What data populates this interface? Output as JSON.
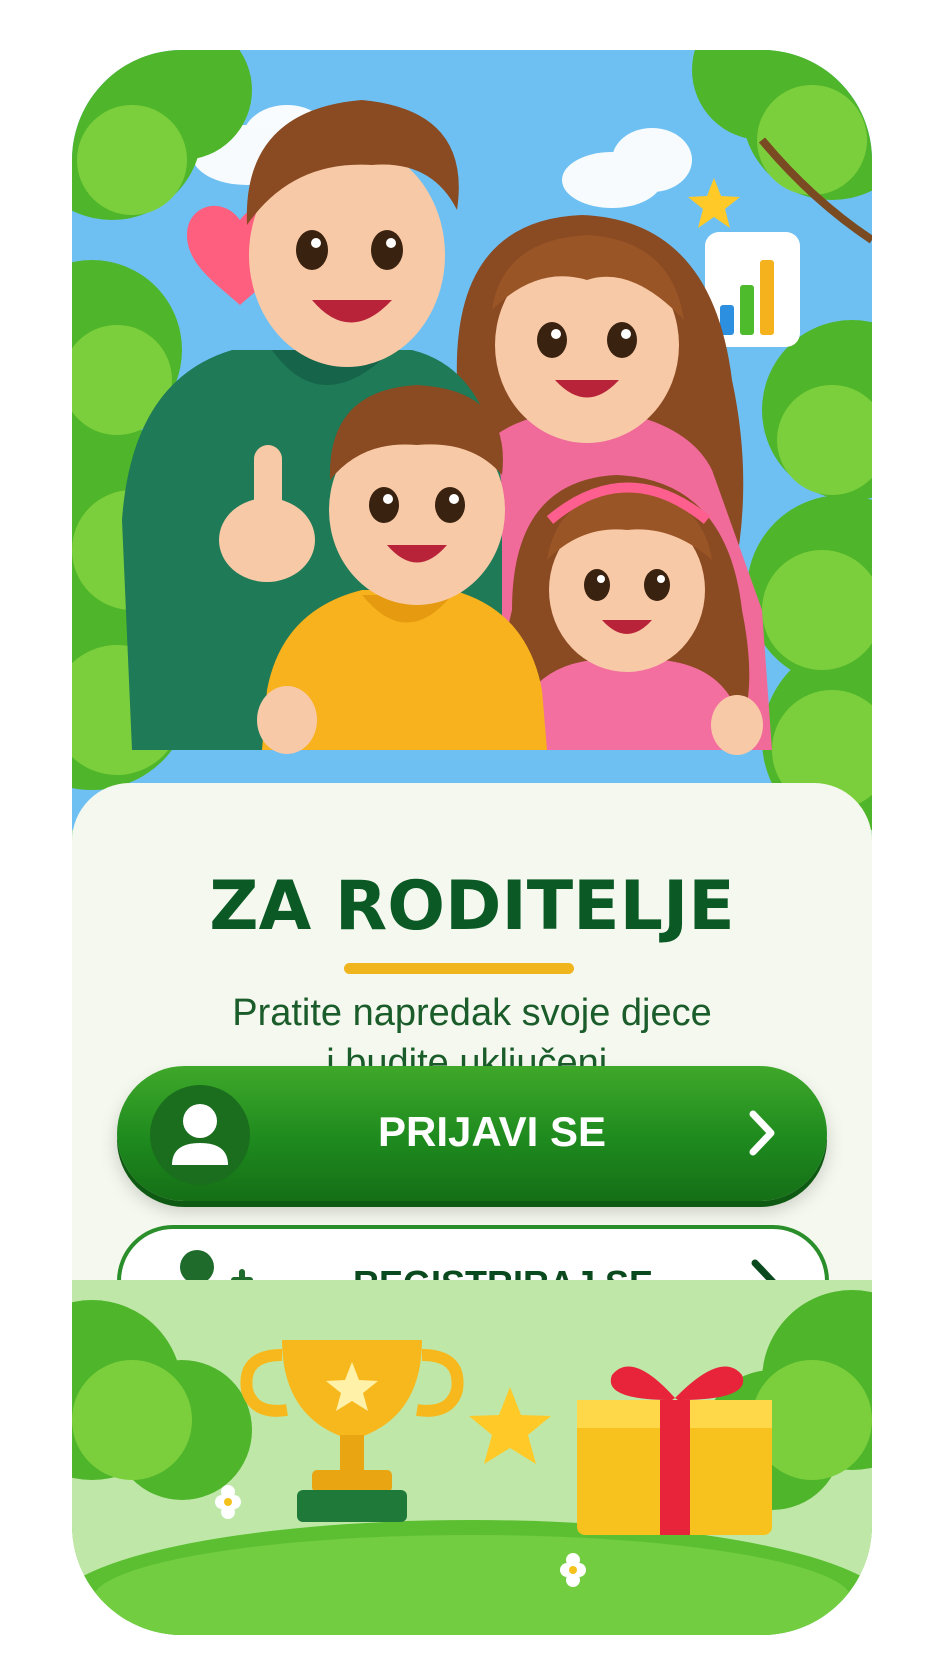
{
  "header": {
    "title": "ZA RODITELJE",
    "subtitle_line1": "Pratite napredak svoje djece",
    "subtitle_line2": "i budite uključeni."
  },
  "actions": {
    "login_label": "PRIJAVI SE",
    "register_label": "REGISTRIRAJ SE"
  },
  "icons": {
    "hero": "family-illustration",
    "decor_top": [
      "heart-icon",
      "star-icon",
      "bar-chart-icon"
    ],
    "decor_bottom": [
      "trophy-icon",
      "star-icon",
      "gift-icon"
    ],
    "login": "user-icon",
    "register": "add-user-icon",
    "chevron": "chevron-right-icon"
  },
  "colors": {
    "primary_green": "#1e8a1e",
    "title_green": "#0b5a26",
    "accent_yellow": "#f0b51c",
    "card_background": "#f4f8ee"
  }
}
